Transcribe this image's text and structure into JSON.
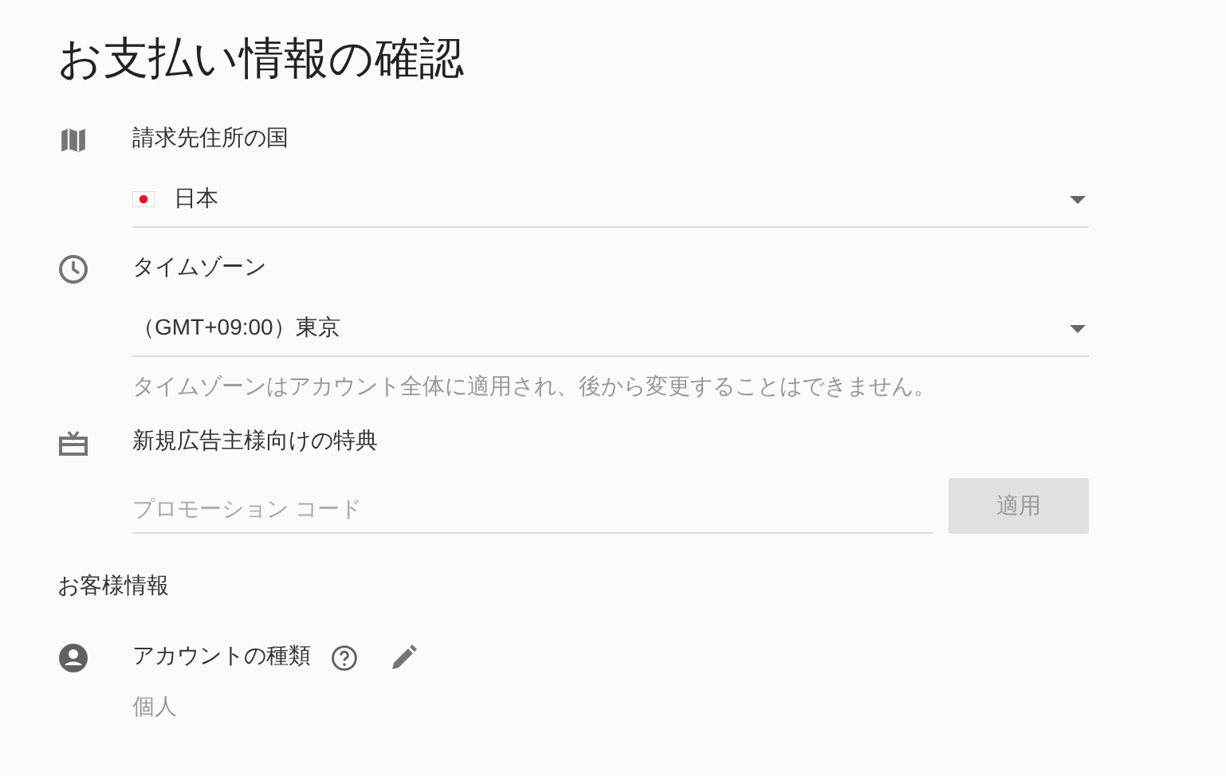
{
  "title": "お支払い情報の確認",
  "country": {
    "label": "請求先住所の国",
    "value": "日本"
  },
  "timezone": {
    "label": "タイムゾーン",
    "value": "（GMT+09:00）東京",
    "hint": "タイムゾーンはアカウント全体に適用され、後から変更することはできません。"
  },
  "promo": {
    "label": "新規広告主様向けの特典",
    "placeholder": "プロモーション コード",
    "button": {
      "label": "適用",
      "disabled": true
    }
  },
  "customer": {
    "heading": "お客様情報",
    "account_type_label": "アカウントの種類",
    "account_type_value": "個人"
  }
}
